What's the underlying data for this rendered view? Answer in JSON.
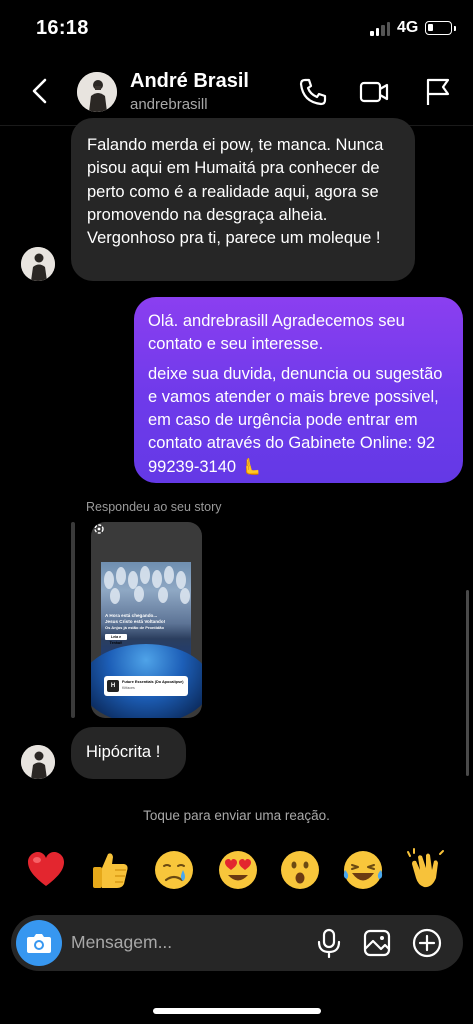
{
  "status_bar": {
    "time": "16:18",
    "network": "4G"
  },
  "header": {
    "name": "André Brasil",
    "username": "andrebrasill"
  },
  "messages": {
    "incoming_1": "Falando merda ei pow, te manca. Nunca pisou aqui em Humaitá pra conhecer de perto como é a realidade aqui, agora se promovendo na desgraça alheia. Vergonhoso pra ti, parece um moleque !",
    "outgoing_1": {
      "line1": "Olá.  andrebrasill  Agradecemos seu contato e seu interesse.",
      "line2": "deixe sua duvida, denuncia ou sugestão e vamos atender o mais breve possivel, em caso de urgência pode entrar em contato através do Gabinete Online: 92 99239-3140 🫷"
    },
    "reply_label": "Respondeu ao seu story",
    "story": {
      "headline1": "A Hora está chegando...",
      "headline2": "Jesus Cristo está Voltando!",
      "headline3": "Os Anjos já estão de Prontidão",
      "button": "Leia e Tenha!!",
      "music_title": "Future Essentials (Do Apocalipse)",
      "music_artist": "Kitfaces"
    },
    "incoming_2": "Hipócrita !"
  },
  "reaction_hint": "Toque para enviar uma reação.",
  "reactions": [
    "❤️",
    "👍",
    "😢",
    "😍",
    "😮",
    "😂",
    "👏"
  ],
  "composer": {
    "placeholder": "Mensagem..."
  }
}
